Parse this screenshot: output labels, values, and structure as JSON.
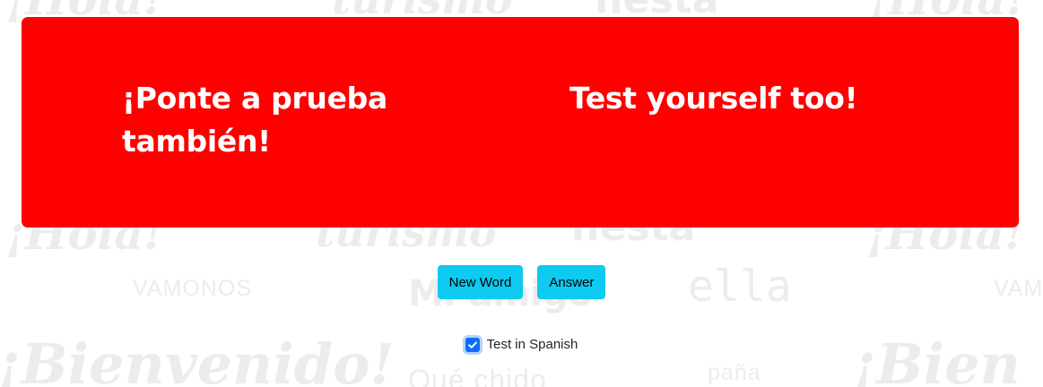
{
  "banner": {
    "spanish_prompt": "¡Ponte a prueba también!",
    "english_prompt": "Test yourself too!",
    "color": "#ff0000"
  },
  "controls": {
    "new_word_label": "New Word",
    "answer_label": "Answer",
    "button_color": "#0dcaf0"
  },
  "settings": {
    "test_in_spanish_label": "Test in Spanish",
    "test_in_spanish_checked": true,
    "checkbox_color": "#0d6efd"
  },
  "background_words": [
    "¡Hola!",
    "turismo",
    "fiesta",
    "¡Hola!",
    "VAMONOS",
    "Mi amigo",
    "ella",
    "VAMO",
    "¡Bienvenido!",
    "Qué chido",
    "paña",
    "¡Bien"
  ]
}
